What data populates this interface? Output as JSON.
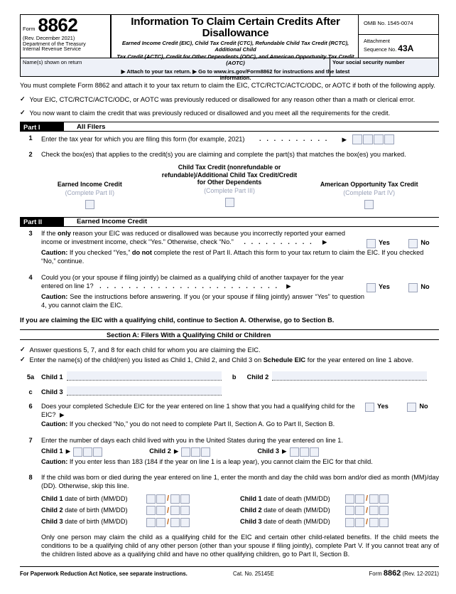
{
  "header": {
    "form_word": "Form",
    "form_number": "8862",
    "revision": "(Rev. December 2021)",
    "dept_line1": "Department of the Treasury",
    "dept_line2": "Internal Revenue Service",
    "title": "Information To Claim Certain Credits After Disallowance",
    "subtitle_line1": "Earned Income Credit (EIC), Child Tax Credit (CTC), Refundable Child Tax Credit (RCTC), Additional Child",
    "subtitle_line2": "Tax Credit (ACTC), Credit for Other Dependents (ODC), and American Opportunity Tax Credit (AOTC)",
    "attach_line": "▶ Attach to your tax return. ▶ Go to www.irs.gov/Form8862 for instructions and the latest information.",
    "omb": "OMB No. 1545-0074",
    "attachment_label_line1": "Attachment",
    "attachment_label_line2": "Sequence No.",
    "attachment_number": "43A"
  },
  "name_row": {
    "name_label": "Name(s) shown on return",
    "ssn_label": "Your social security number"
  },
  "intro": {
    "text": "You must complete Form 8862 and attach it to your tax return to claim the EIC, CTC/RCTC/ACTC/ODC, or AOTC if both of the following apply.",
    "bullet1": "Your EIC, CTC/RCTC/ACTC/ODC, or AOTC was previously reduced or disallowed for any reason other than a math or clerical error.",
    "bullet2": "You now want to claim the credit that was previously reduced or disallowed and you meet all the requirements for the credit.",
    "check_glyph": "✓"
  },
  "part1": {
    "tag": "Part I",
    "title": "All Filers",
    "line1": {
      "num": "1",
      "text": "Enter the tax year for which you are filing this form (for example, 2021)",
      "dots": ". . . . . . . . . .",
      "arrow": "▶",
      "box_count": 4
    },
    "line2": {
      "num": "2",
      "text": "Check the box(es) that applies to the credit(s) you are claiming and complete the part(s) that matches the box(es) you marked.",
      "credits": [
        {
          "title": "Earned Income Credit",
          "sub": "(Complete Part II)"
        },
        {
          "title": "Child Tax Credit (nonrefundable or refundable)/Additional Child Tax Credit/Credit for Other Dependents",
          "sub": "(Complete Part III)"
        },
        {
          "title": "American Opportunity Tax Credit",
          "sub": "(Complete Part IV)"
        }
      ]
    }
  },
  "part2": {
    "tag": "Part II",
    "title": "Earned Income Credit",
    "line3": {
      "num": "3",
      "text_a": "If the ",
      "text_bold1": "only",
      "text_b": " reason your EIC was reduced or disallowed was because you incorrectly reported your earned income or investment income, check “Yes.” Otherwise, check “No.”",
      "dots": ". . . . . . . . . .",
      "arrow": "▶",
      "caution_label": "Caution:",
      "caution_a": " If you checked “Yes,” ",
      "caution_bold": "do not",
      "caution_b": " complete the rest of Part II. Attach this form to your tax return to claim the EIC. If you checked “No,” continue.",
      "yes": "Yes",
      "no": "No"
    },
    "line4": {
      "num": "4",
      "text": "Could you (or your spouse if filing jointly) be claimed as a qualifying child of another taxpayer for the year entered on line 1?",
      "dots": ". . . . . . . . . . . . . . . . . . . . . . . . .",
      "arrow": "▶",
      "caution_label": "Caution:",
      "caution_text": " See the instructions before answering. If you (or your spouse if filing jointly) answer “Yes” to question 4, you cannot claim the EIC.",
      "yes": "Yes",
      "no": "No"
    },
    "statement": "If you are claiming the EIC with a qualifying child, continue to Section A. Otherwise, go to Section B.",
    "section_a": {
      "title": "Section A: Filers With a Qualifying Child or Children",
      "bullet1": "Answer questions 5, 7, and 8 for each child for whom you are claiming the EIC.",
      "bullet2_a": "Enter the name(s) of the child(ren) you listed as Child 1, Child 2, and Child 3 on ",
      "bullet2_bold": "Schedule EIC",
      "bullet2_b": " for the year entered on line 1 above.",
      "line5": {
        "a_idx": "5a",
        "a_label": "Child 1",
        "b_idx": "b",
        "b_label": "Child 2",
        "c_idx": "c",
        "c_label": "Child 3"
      },
      "line6": {
        "num": "6",
        "text": "Does your completed Schedule EIC for the year entered on line 1 show that you had a qualifying child for the EIC?",
        "arrow": "▶",
        "yes": "Yes",
        "no": "No",
        "caution_label": "Caution:",
        "caution_text": " If you checked “No,” you do not need to complete Part II, Section A. Go to Part II, Section B."
      },
      "line7": {
        "num": "7",
        "text": "Enter the number of days each child lived with you in the United States during the year entered on line 1.",
        "children": [
          "Child 1",
          "Child 2",
          "Child 3"
        ],
        "arrow": "▶",
        "box_count": 3,
        "caution_label": "Caution:",
        "caution_text": "  If you enter less than 183 (184 if the year on line 1 is a leap year), you cannot claim the EIC for that child."
      },
      "line8": {
        "num": "8",
        "text": "If the child was born or died during the year entered on line 1, enter the month and day the child was born and/or died as month (MM)/day (DD). Otherwise, skip this line.",
        "birth_rows": [
          {
            "bold": "Child 1",
            "rest": " date of birth (MM/DD)"
          },
          {
            "bold": "Child 2",
            "rest": " date of birth (MM/DD)"
          },
          {
            "bold": "Child 3",
            "rest": " date of birth (MM/DD)"
          }
        ],
        "death_rows": [
          {
            "bold": "Child 1",
            "rest": " date of death (MM/DD)"
          },
          {
            "bold": "Child 2",
            "rest": " date of death (MM/DD)"
          },
          {
            "bold": "Child 3",
            "rest": " date of death (MM/DD)"
          }
        ],
        "separator": "/",
        "footnote": "Only one person may claim the child as a qualifying child for the EIC and certain other child-related benefits. If the child meets the conditions to be a qualifying child of any other person (other than your spouse if filing jointly), complete Part V. If you cannot treat any of the children listed above as a qualifying child and have no other qualifying children, go to Part II, Section B."
      }
    }
  },
  "footer": {
    "paperwork": "For Paperwork Reduction Act Notice, see separate instructions.",
    "cat": "Cat. No. 25145E",
    "form_word": "Form",
    "form_number": "8862",
    "form_rev": "(Rev. 12-2021)"
  },
  "colors": {
    "field_fill": "#eef1f8",
    "field_border": "#9aa2b8",
    "accent_slash": "#c06010",
    "bar_bg": "#000000"
  }
}
